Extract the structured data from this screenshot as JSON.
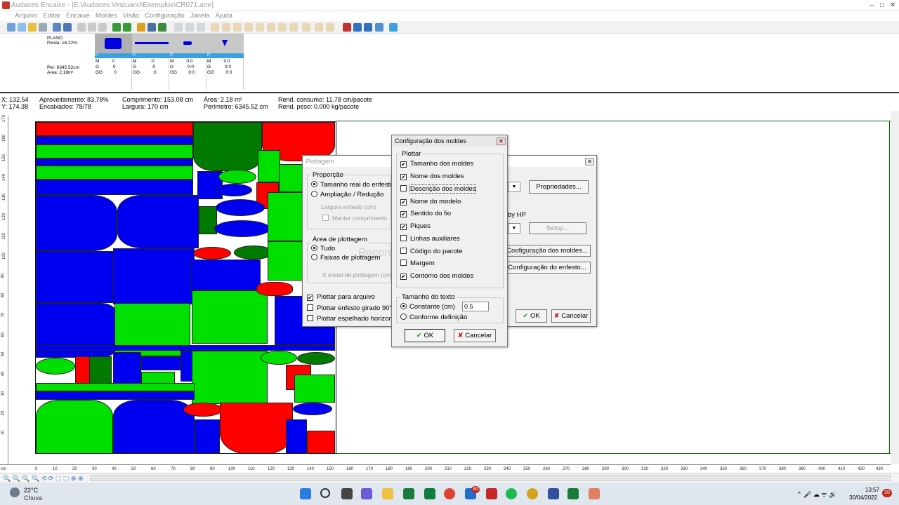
{
  "window": {
    "title": "Audaces Encaixe - [E:\\Audaces Vestuario\\Exemplos\\CR071.amr]"
  },
  "menu": [
    "Arquivo",
    "Editar",
    "Encaixe",
    "Moldes",
    "Visão",
    "Configuração",
    "Janela",
    "Ajuda"
  ],
  "panel": {
    "title": "PLANO",
    "perda": "Perda: 16.22%",
    "per": "Per: 6345.52cm",
    "area": "Area: 2.18m²",
    "combo_value": "1",
    "columns": [
      {
        "head": "P",
        "rows": [
          "M          0",
          "G           0",
          "GG         0"
        ]
      },
      {
        "head": "P",
        "rows": [
          "M           :0",
          "G            :0",
          "GG          :0"
        ]
      },
      {
        "head": "P",
        "rows": [
          "M          0:0",
          "G           0:0",
          "GG         0:0"
        ]
      },
      {
        "head": "P",
        "rows": [
          "M          0:0",
          "G           0:0",
          "GG         0:0"
        ]
      }
    ]
  },
  "stats": {
    "x": "X: 132.54",
    "y": "Y: 174.38",
    "aproveitamento": "Aproveitamento: 83.78%",
    "encaixados": "Encaixados: 78/78",
    "comprimento": "Comprimento: 153.08 cm",
    "largura": "Largura: 170 cm",
    "area": "Área: 2.18 m²",
    "perimetro": "Perímetro: 6345.52 cm",
    "rend_consumo": "Rend. consumo: 11.78 cm/pacote",
    "rend_peso": "Rend. peso: 0.000 kg/pacote"
  },
  "hruler": {
    "unit": "cm",
    "ticks": [
      "0",
      "10",
      "20",
      "30",
      "40",
      "50",
      "60",
      "70",
      "80",
      "90",
      "100",
      "110",
      "120",
      "130",
      "140",
      "150",
      "160",
      "170",
      "180",
      "190",
      "200",
      "210",
      "220",
      "230",
      "240",
      "250",
      "260",
      "270",
      "280",
      "290",
      "300",
      "310",
      "320",
      "330",
      "340",
      "350",
      "360",
      "370",
      "380",
      "390",
      "400",
      "410",
      "420",
      "430"
    ]
  },
  "vruler": {
    "ticks": [
      "170",
      "160",
      "150",
      "140",
      "130",
      "120",
      "110",
      "100",
      "90",
      "80",
      "70",
      "60",
      "50",
      "40",
      "30",
      "20",
      "10"
    ]
  },
  "plottagem": {
    "title": "Plottagem",
    "proporcao_label": "Proporção",
    "tamanho_real": "Tamanho real do enfesto",
    "ampliacao": "Ampliação / Redução",
    "largura_enfesto": "Largura enfesto (cm)",
    "manter_comprimento": "Manter comprimento",
    "area_label": "Área de plottagem",
    "tudo": "Tudo",
    "faixas": "Faixas de plottagem",
    "xinicial": "X inicial de plottagem (cm)",
    "plotar_arquivo": "Plottar para arquivo",
    "plotar_girado": "Plottar enfesto girado 90°",
    "plotar_espelhado": "Plottar espelhado horizontal",
    "propriedades": "Propriedades...",
    "hp_label": "by HP",
    "setup": "Setup...",
    "config_moldes": "Configuração dos moldes...",
    "config_enfesto": "Configuração do enfesto...",
    "ok": "OK",
    "cancelar": "Cancelar"
  },
  "config": {
    "title": "Configuração dos moldes",
    "plottar_label": "Plottar",
    "options": [
      {
        "label": "Tamanho dos moldes",
        "checked": "✔"
      },
      {
        "label": "Nome dos moldes",
        "checked": "✔"
      },
      {
        "label": "Descrição dos moldes",
        "checked": ""
      },
      {
        "label": "Nome do modelo",
        "checked": "✔"
      },
      {
        "label": "Sentido do fio",
        "checked": "✔"
      },
      {
        "label": "Piques",
        "checked": "✔"
      },
      {
        "label": "Linhas auxiliares",
        "checked": ""
      },
      {
        "label": "Código do pacote",
        "checked": ""
      },
      {
        "label": "Margem",
        "checked": ""
      },
      {
        "label": "Contorno dos moldes",
        "checked": "✔"
      }
    ],
    "texto_label": "Tamanho do texto",
    "constante": "Constante (cm)",
    "constante_value": "0.5",
    "conforme": "Conforme definição",
    "ok": "OK",
    "cancelar": "Cancelar"
  },
  "watermark": "Recorded with iTop Screen Recorder",
  "taskbar": {
    "temp": "22°C",
    "weather": "Chuva",
    "time": "13:57",
    "date": "30/04/2022",
    "mail_badge": "30",
    "notif": "20"
  }
}
